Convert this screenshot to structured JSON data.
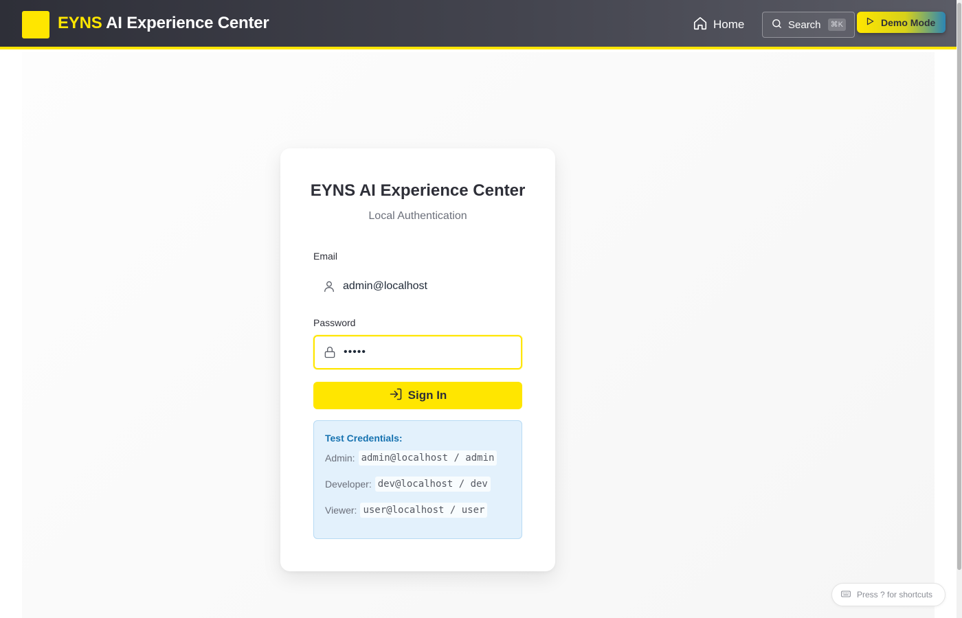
{
  "header": {
    "brand_accent": "EYNS",
    "brand_rest": " AI Experience Center",
    "home_label": "Home",
    "search_label": "Search",
    "search_shortcut": "⌘K",
    "demo_label": "Demo Mode",
    "accent_color": "#ffe600",
    "icons": [
      "home-icon",
      "search-icon",
      "play-icon"
    ]
  },
  "login": {
    "title": "EYNS AI Experience Center",
    "subtitle": "Local Authentication",
    "email_label": "Email",
    "email_value": "admin@localhost",
    "password_label": "Password",
    "password_value": "admin",
    "signin_label": "Sign In",
    "icons": [
      "user-icon",
      "lock-icon",
      "sign-in-icon"
    ]
  },
  "credentials": {
    "title": "Test Credentials:",
    "rows": [
      {
        "role": "Admin:",
        "value": "admin@localhost / admin"
      },
      {
        "role": "Developer:",
        "value": "dev@localhost / dev"
      },
      {
        "role": "Viewer:",
        "value": "user@localhost / user"
      }
    ]
  },
  "footer": {
    "shortcut_hint": "Press ? for shortcuts",
    "icon": "keyboard-icon"
  }
}
